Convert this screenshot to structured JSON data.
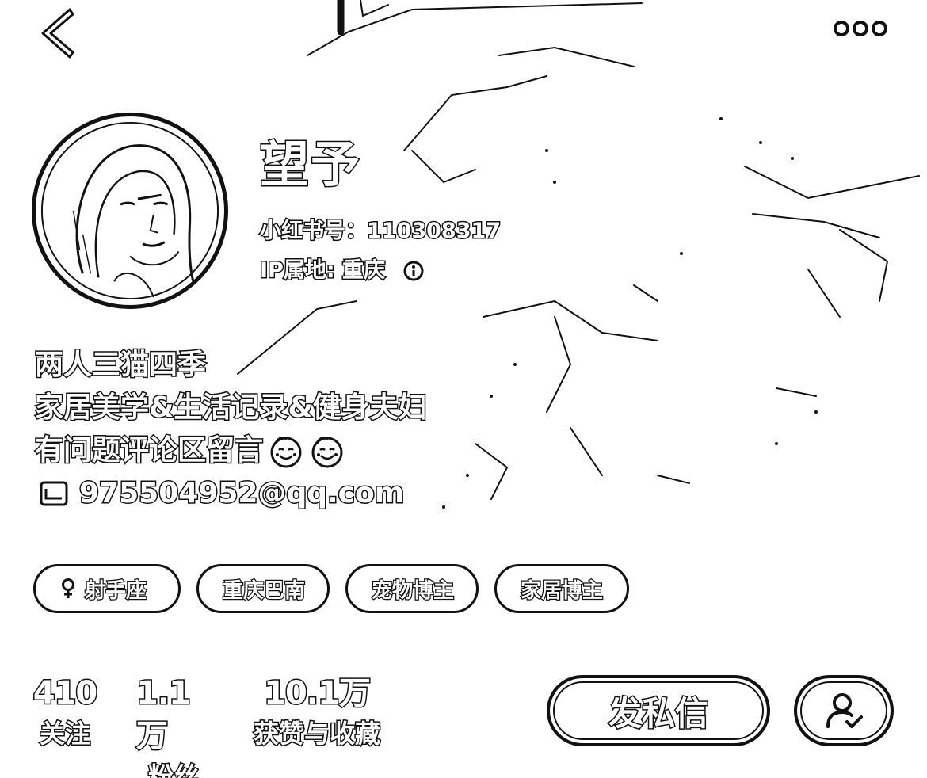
{
  "header": {
    "back_icon": "chevron-left-icon",
    "more_icon": "more-dots-icon"
  },
  "profile": {
    "avatar_icon": "avatar-portrait",
    "name": "望予",
    "red_id": "小红书号：110308317",
    "ip_location": "IP属地: 重庆",
    "ip_info_icon": "info-icon"
  },
  "bio": {
    "line1": "两人三猫四季",
    "line2": "家居美学&生活记录&健身夫妇",
    "line3": "有问题评论区留言",
    "line3_emojis": [
      "smiling-face-icon",
      "smiling-face-icon"
    ],
    "email": "975504952@qq.com",
    "email_icon": "mail-icon"
  },
  "tags": [
    {
      "label": "射手座",
      "icon": "female-icon"
    },
    {
      "label": "重庆巴南"
    },
    {
      "label": "宠物博主"
    },
    {
      "label": "家居博主"
    }
  ],
  "stats": {
    "follow_count": "410",
    "follow_label": "关注",
    "fans_count": "1.1万",
    "fans_label": "粉丝",
    "likes_count": "10.1万",
    "likes_label": "获赞与收藏"
  },
  "actions": {
    "message_label": "发私信",
    "followed_icon": "user-check-icon"
  }
}
